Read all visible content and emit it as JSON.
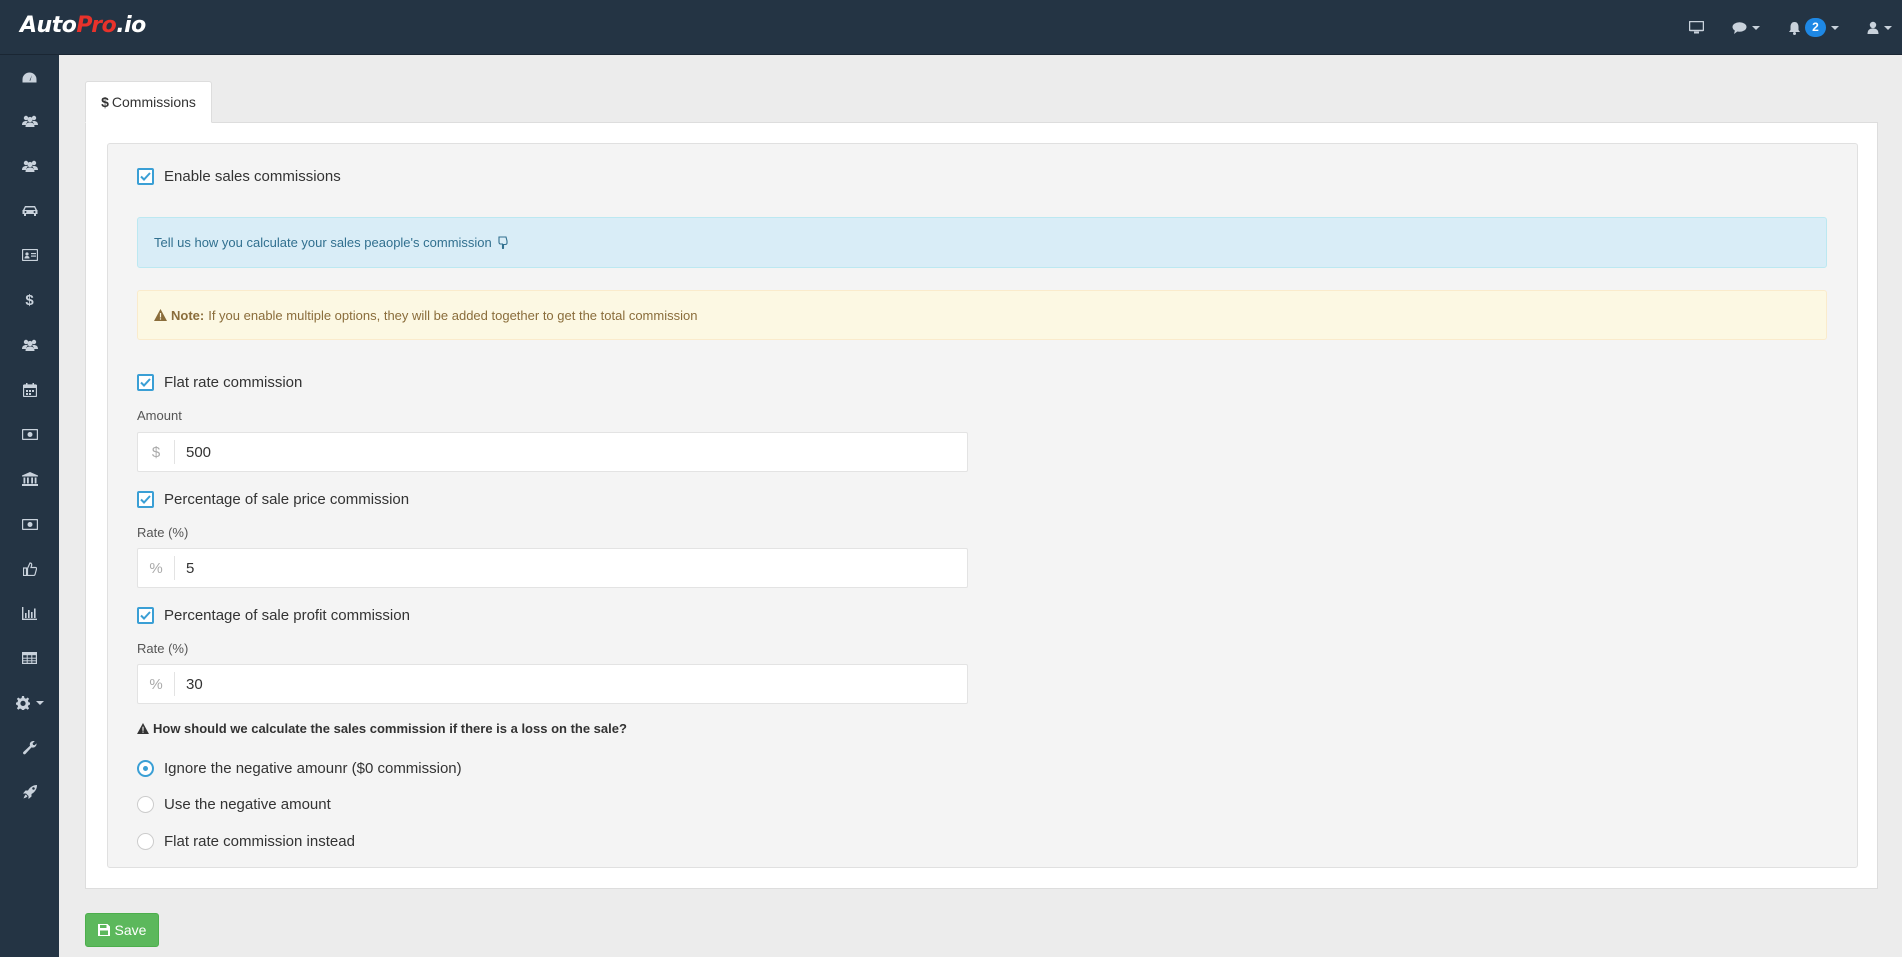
{
  "app": {
    "logo_auto": "Auto",
    "logo_pro": "Pro",
    "logo_io": ".io"
  },
  "topnav": {
    "notification_count": "2",
    "icons": [
      "monitor-icon",
      "chat-icon",
      "bell-icon",
      "user-icon"
    ]
  },
  "sidebar": {
    "items": [
      "dashboard-icon",
      "users-icon",
      "group-icon",
      "car-icon",
      "id-card-icon",
      "dollar-icon",
      "team-icon",
      "calendar-icon",
      "money-icon",
      "bank-icon",
      "cash-icon",
      "thumbs-up-icon",
      "bar-chart-icon",
      "table-icon",
      "settings-icon",
      "wrench-icon",
      "rocket-icon"
    ],
    "dollar_glyph": "$"
  },
  "tabs": {
    "commissions_icon": "$",
    "commissions_label": "Commissions"
  },
  "form": {
    "enable_label": "Enable sales commissions",
    "info_text": "Tell us how you calculate your sales peaople's commission",
    "note_title": "Note:",
    "note_text": "If you enable multiple options, they will be added together to get the total commission",
    "flat": {
      "label": "Flat rate commission",
      "field_label": "Amount",
      "addon": "$",
      "value": "500"
    },
    "price": {
      "label": "Percentage of sale price commission",
      "field_label": "Rate (%)",
      "addon": "%",
      "value": "5"
    },
    "profit": {
      "label": "Percentage of sale profit commission",
      "field_label": "Rate (%)",
      "addon": "%",
      "value": "30"
    },
    "loss_question": "How should we calculate the sales commission if there is a loss on the sale?",
    "loss_options": [
      "Ignore the negative amounr ($0 commission)",
      "Use the negative amount",
      "Flat rate commission instead"
    ],
    "loss_selected": 0
  },
  "actions": {
    "save_label": "Save"
  },
  "colors": {
    "topbar": "#243444",
    "accent": "#3a9fd5",
    "save": "#5cb85c",
    "badge": "#1e88e5"
  }
}
